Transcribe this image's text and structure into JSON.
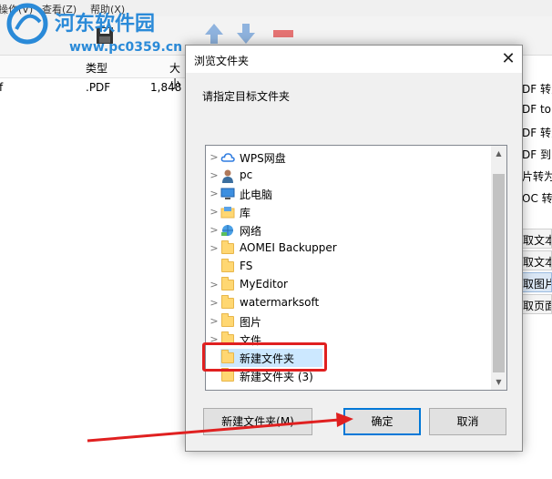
{
  "app": {
    "menu": [
      "操作(V)",
      "查看(Z)",
      "帮助(X)"
    ],
    "watermark": {
      "title": "河东软件园",
      "url": "www.pc0359.cn"
    },
    "list_header": {
      "type": "类型",
      "size": "大小"
    },
    "list_row": {
      "name_fragment": "f",
      "type": ".PDF",
      "size": "1,848"
    },
    "right_items": [
      "DF 转为",
      "DF to I",
      "DF 转为",
      "DF 到 I",
      "片转为",
      "OC 转"
    ],
    "right_buttons": [
      "取文本",
      "取文本",
      "取图片",
      "取页面"
    ]
  },
  "dialog": {
    "title": "浏览文件夹",
    "close_glyph": "✕",
    "prompt": "请指定目标文件夹",
    "tree": [
      {
        "label": "WPS网盘",
        "icon": "cloud-icon",
        "expandable": true
      },
      {
        "label": "pc",
        "icon": "user-icon",
        "expandable": true
      },
      {
        "label": "此电脑",
        "icon": "computer-icon",
        "expandable": true
      },
      {
        "label": "库",
        "icon": "library-icon",
        "expandable": true
      },
      {
        "label": "网络",
        "icon": "network-icon",
        "expandable": true
      },
      {
        "label": "AOMEI Backupper",
        "icon": "folder-icon",
        "expandable": true
      },
      {
        "label": "FS",
        "icon": "folder-icon",
        "expandable": false
      },
      {
        "label": "MyEditor",
        "icon": "folder-icon",
        "expandable": true
      },
      {
        "label": "watermarksoft",
        "icon": "folder-icon",
        "expandable": true
      },
      {
        "label": "图片",
        "icon": "folder-icon",
        "expandable": true
      },
      {
        "label": "文件",
        "icon": "folder-icon",
        "expandable": true
      },
      {
        "label": "新建文件夹",
        "icon": "folder-icon",
        "expandable": false,
        "selected": true
      },
      {
        "label": "新建文件夹 (3)",
        "icon": "folder-icon",
        "expandable": false
      }
    ],
    "buttons": {
      "new_folder": "新建文件夹(M)",
      "ok": "确定",
      "cancel": "取消"
    }
  },
  "colors": {
    "annotation": "#e02020",
    "selection": "#cce8ff",
    "accent": "#0078d7"
  }
}
